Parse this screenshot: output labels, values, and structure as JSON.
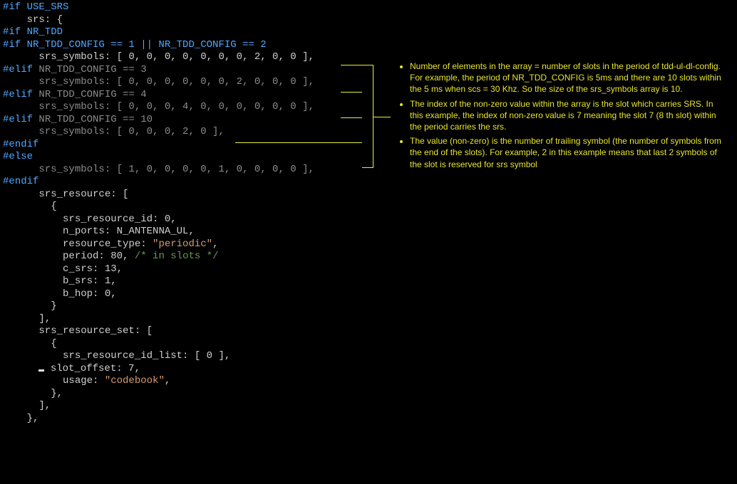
{
  "code": {
    "l1_pp": "#if USE_SRS",
    "l2": "    srs: {",
    "l3_pp": "#if NR_TDD",
    "l4_pp": "#if NR_TDD_CONFIG == 1 || NR_TDD_CONFIG == 2",
    "l5_indent": "      srs_symbols: [ 0, 0, 0, 0, 0, 0, 0, 2, 0, 0 ],",
    "l6_pp_k": "#elif ",
    "l6_dim": "NR_TDD_CONFIG == 3",
    "l7_dim": "      srs_symbols: [ 0, 0, 0, 0, 0, 0, 2, 0, 0, 0 ],",
    "l8_pp_k": "#elif ",
    "l8_dim": "NR_TDD_CONFIG == 4",
    "l9_dim": "      srs_symbols: [ 0, 0, 0, 4, 0, 0, 0, 0, 0, 0 ],",
    "l10_pp_k": "#elif ",
    "l10_dim": "NR_TDD_CONFIG == 10",
    "l11_dim": "      srs_symbols: [ 0, 0, 0, 2, 0 ],",
    "l12_pp": "#endif",
    "l13_pp": "#else",
    "l14_dim": "      srs_symbols: [ 1, 0, 0, 0, 0, 1, 0, 0, 0, 0 ],",
    "l15_pp": "#endif",
    "res_open": "      srs_resource: [",
    "brace_o": "        {",
    "res_id_k": "          srs_resource_id: ",
    "res_id_v": "0",
    "nports_k": "          n_ports: ",
    "nports_v": "N_ANTENNA_UL",
    "rtype_k": "          resource_type: ",
    "rtype_v": "\"periodic\"",
    "period_k": "          period: ",
    "period_v": "80",
    "period_c": " /* in slots */",
    "csrs_k": "          c_srs: ",
    "csrs_v": "13",
    "bsrs_k": "          b_srs: ",
    "bsrs_v": "1",
    "bhop_k": "          b_hop: ",
    "bhop_v": "0",
    "brace_c": "        }",
    "arr_c": "      ],",
    "set_open": "      srs_resource_set: [",
    "set_brace_o": "        {",
    "idlist_k": "          srs_resource_id_list: [ ",
    "idlist_v": "0",
    "idlist_e": " ],",
    "slotoff_pre": "      ",
    "slotoff_k": " slot_offset: ",
    "slotoff_v": "7",
    "usage_k": "          usage: ",
    "usage_v": "\"codebook\"",
    "set_brace_c": "        },",
    "set_arr_c": "      ],",
    "srs_close": "    },"
  },
  "annot": {
    "b1": "Number of elements in the array = number of slots in the period of tdd-ul-dl-config.  For example, the period of NR_TDD_CONFIG is 5ms and there are 10 slots within the 5 ms when scs = 30 Khz. So the size of the srs_symbols array is 10.",
    "b2": "The index of the non-zero value within the array is the slot which carries SRS. In this example, the index of non-zero value is 7 meaning the slot 7 (8 th slot) within the period carries the srs.",
    "b3": "The value (non-zero) is the number of trailing symbol (the number of symbols from the end of the slots). For example, 2 in this example means that last 2 symbols of the slot is reserved for srs symbol"
  }
}
